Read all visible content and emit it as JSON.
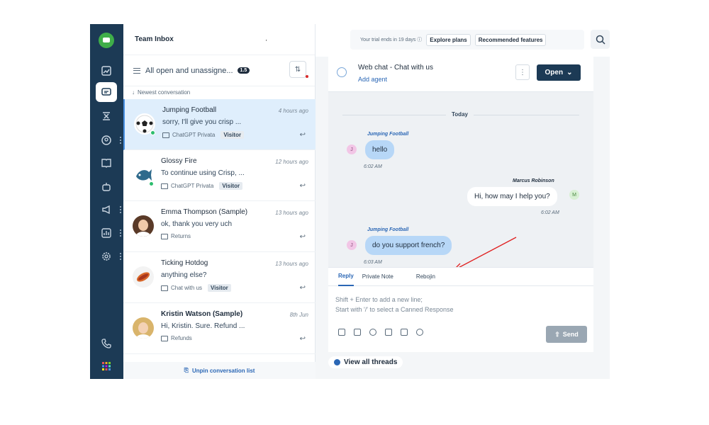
{
  "header": {
    "title": "Team Inbox",
    "trial_text": "Your trial ends in 19 days ⓘ",
    "explore_label": "Explore plans",
    "features_label": "Recommended features"
  },
  "filter": {
    "label": "All open and unassigne...",
    "count": "1.5"
  },
  "sort_label": "Newest conversation",
  "conversations": [
    {
      "name": "Jumping Football",
      "time": "4 hours ago",
      "preview": "sorry, I'll give you crisp ...",
      "channel": "ChatGPT Privata",
      "badge": "Visitor"
    },
    {
      "name": "Glossy Fire",
      "time": "12 hours ago",
      "preview": "To continue using Crisp, ...",
      "channel": "ChatGPT Privata",
      "badge": "Visitor"
    },
    {
      "name": "Emma Thompson (Sample)",
      "time": "13 hours ago",
      "preview": "ok, thank you very uch",
      "channel": "Returns",
      "badge": ""
    },
    {
      "name": "Ticking Hotdog",
      "time": "13 hours ago",
      "preview": "anything else?",
      "channel": "Chat with us",
      "badge": "Visitor"
    },
    {
      "name": "Kristin Watson (Sample)",
      "time": "8th Jun",
      "preview": "Hi, Kristin. Sure. Refund ...",
      "channel": "Refunds",
      "badge": ""
    }
  ],
  "unpin_label": "Unpin conversation list",
  "chat": {
    "title": "Web chat - Chat with us",
    "add_agent": "Add agent",
    "kebab": "⋮",
    "status_button": "Open",
    "day": "Today",
    "messages": [
      {
        "sender": "Jumping Football",
        "text": "hello",
        "time": "6:02 AM"
      },
      {
        "sender": "Marcus Robinson",
        "text": "Hi, how may I help you?",
        "time": "6:02 AM"
      },
      {
        "sender": "Jumping Football",
        "text": "do you support french?",
        "time": "6:03 AM"
      }
    ],
    "tabs": [
      "Reply",
      "Private Note",
      "Rebojin"
    ],
    "placeholder_1": "Shift + Enter to add a new line;",
    "placeholder_2": "Start with '/' to select a Canned Response",
    "send_label": "Send",
    "view_threads": "View all threads"
  },
  "colors": {
    "rail": "#1c3a55",
    "accent": "#2b67b5",
    "bubble_in": "#b7d7f7",
    "active_row": "#dfeefc"
  }
}
